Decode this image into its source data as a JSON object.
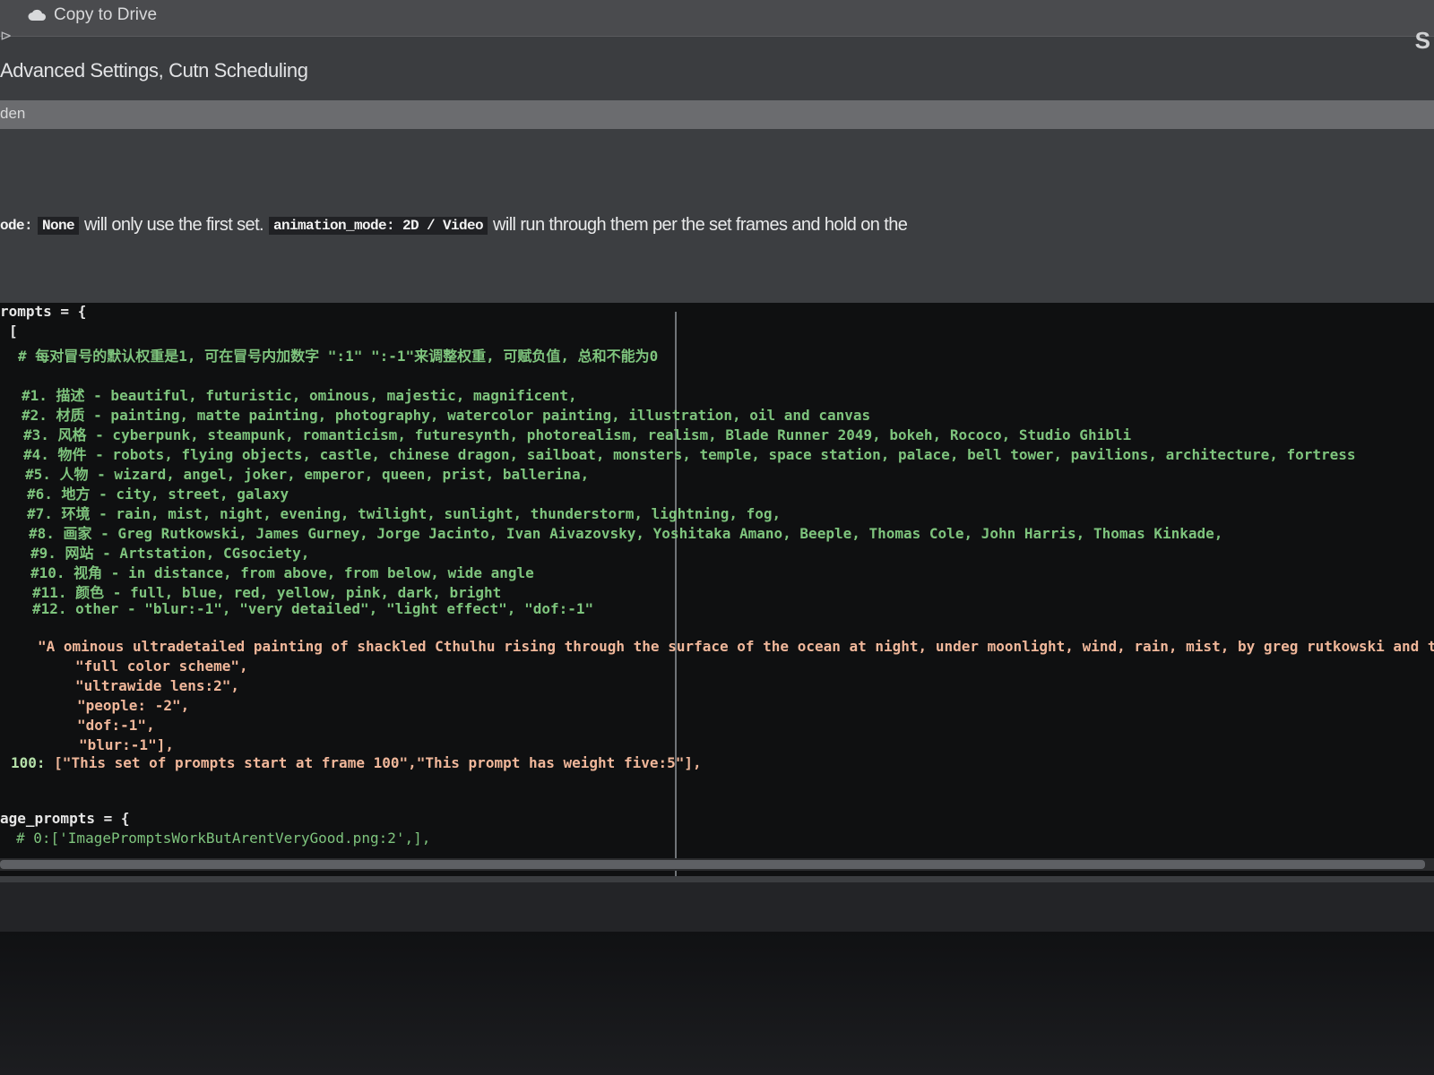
{
  "toolbar": {
    "copy_to_drive_label": "Copy to Drive",
    "left_glyph": "⊳",
    "right_glyph": "S"
  },
  "section": {
    "title": "Advanced Settings, Cutn Scheduling",
    "hidden_label": "den"
  },
  "description": {
    "prefix": "ode:",
    "chip_none": "None",
    "text1": "will only use the first set.",
    "chip_mode": "animation_mode: 2D / Video",
    "text2": "will run through them per the set frames and hold on the"
  },
  "code": {
    "prompts_decl": "rompts = {",
    "open_bracket": "[",
    "comment_weight": "# 每对冒号的默认权重是1, 可在冒号内加数字 \":1\" \":-1\"来调整权重, 可赋负值, 总和不能为0",
    "tags": [
      "#1. 描述 - beautiful, futuristic, ominous, majestic, magnificent,",
      "#2. 材质 - painting, matte painting, photography, watercolor painting, illustration, oil and canvas",
      "#3. 风格 - cyberpunk, steampunk, romanticism, futuresynth, photorealism, realism, Blade Runner 2049, bokeh, Rococo, Studio Ghibli",
      "#4. 物件 - robots, flying objects, castle, chinese dragon, sailboat, monsters, temple, space station, palace, bell tower, pavilions, architecture, fortress",
      "#5. 人物 - wizard, angel, joker, emperor, queen, prist, ballerina,",
      "#6. 地方 - city, street, galaxy",
      "#7. 环境 - rain, mist, night, evening, twilight, sunlight, thunderstorm, lightning, fog,",
      "#8. 画家 - Greg Rutkowski, James Gurney, Jorge Jacinto, Ivan Aivazovsky, Yoshitaka Amano, Beeple, Thomas Cole, John Harris, Thomas Kinkade,",
      "#9. 网站 - Artstation, CGsociety,",
      "#10. 视角 - in distance, from above, from below, wide angle",
      "#11. 颜色 - full, blue, red, yellow, pink, dark, bright",
      "#12. other - \"blur:-1\", \"very detailed\", \"light effect\", \"dof:-1\""
    ],
    "prompt_main": "\"A ominous ultradetailed painting of shackled Cthulhu rising through the surface of the ocean at night, under moonlight, wind, rain, mist, by greg rutkowski and thom",
    "prompt_items": [
      "\"full color scheme\",",
      "\"ultrawide lens:2\",",
      "\"people: -2\",",
      "\"dof:-1\",",
      "\"blur:-1\"],"
    ],
    "line100_key": "100:",
    "line100_value": "[\"This set of prompts start at frame 100\",\"This prompt has weight five:5\"],",
    "image_prompts_decl": "age_prompts = {",
    "image_prompts_comment": "# 0:['ImagePromptsWorkButArentVeryGood.png:2',],"
  },
  "colors": {
    "comment": "#7ec47d",
    "string": "#f0b79a",
    "background": "#0f1011"
  },
  "icons": [
    "cloud-icon"
  ]
}
